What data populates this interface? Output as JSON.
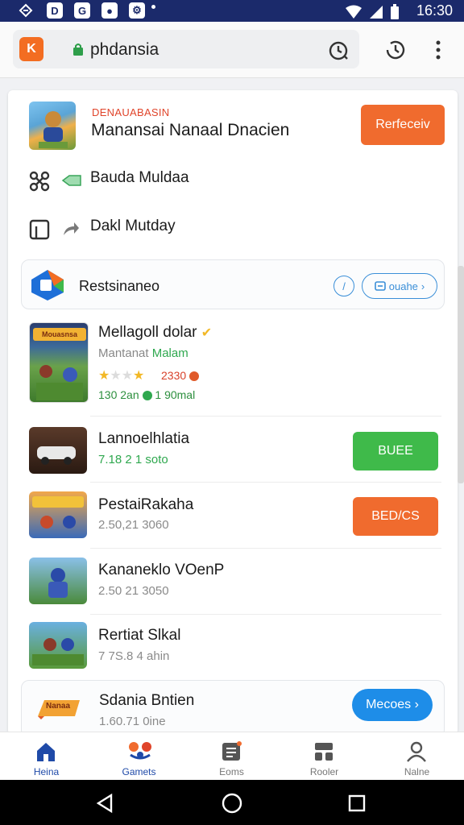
{
  "status_bar": {
    "time": "16:30"
  },
  "browser": {
    "logo_text": "K",
    "url": "phdansia"
  },
  "featured": {
    "kicker": "DENAUABASIN",
    "title": "Manansai Nanaal Dnacien",
    "button": "Rerfeceiv"
  },
  "menu": [
    {
      "label": "Bauda Muldaa"
    },
    {
      "label": "Dakl Mutday"
    }
  ],
  "recommend": {
    "title": "Restsinaneo",
    "pill": "ouahe"
  },
  "top_app": {
    "banner": "Mouasnsa",
    "title": "Mellagoll dolar",
    "sub_a": "Mantanat",
    "sub_b": "Malam",
    "rating": 3,
    "rating_count": "2330",
    "meta_a": "130 2an",
    "meta_b": "1 90mal"
  },
  "apps": [
    {
      "title": "Lannoelhlatia",
      "sub": "7.18 2 1 soto",
      "button": "BUEE",
      "button_color": "green"
    },
    {
      "title": "PestaiRakaha",
      "sub": "2.50,21 3060",
      "button": "BED/CS",
      "button_color": "orange"
    },
    {
      "title": "Kananeklo VOenP",
      "sub": "2.50 21 3050",
      "button": ""
    },
    {
      "title": "Rertiat Slkal",
      "sub": "7 7S.8 4 ahin",
      "button": ""
    }
  ],
  "last_app": {
    "title": "Sdania Bntien",
    "sub": "1.60.71 0ine",
    "banner": "Nanaa",
    "button": "Mecoes"
  },
  "bottom_nav": [
    {
      "label": "Heina"
    },
    {
      "label": "Gamets"
    },
    {
      "label": "Eoms"
    },
    {
      "label": "Rooler"
    },
    {
      "label": "Nalne"
    }
  ],
  "colors": {
    "accent": "#f06b2e",
    "green": "#3fba4a",
    "blue": "#1e8de8",
    "statusbar": "#1b2a6b"
  }
}
